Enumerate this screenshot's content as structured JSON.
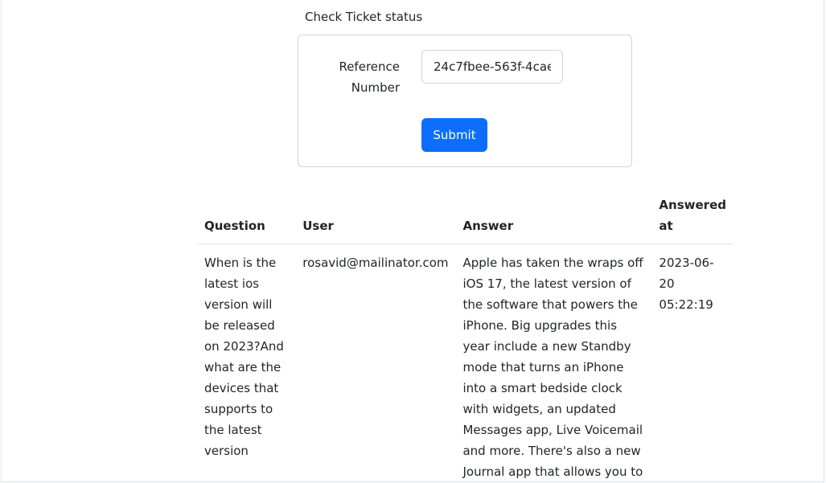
{
  "page": {
    "title": "Check Ticket status"
  },
  "form": {
    "reference_label": "Reference Number",
    "reference_value": "24c7fbee-563f-4cae",
    "submit_label": "Submit"
  },
  "table": {
    "headers": {
      "question": "Question",
      "user": "User",
      "answer": "Answer",
      "answered_at": "Answered at"
    },
    "rows": [
      {
        "question": "When is the latest ios version will be released on 2023?And what are the devices that supports to the latest version",
        "user": "rosavid@mailinator.com",
        "answer": "Apple has taken the wraps off iOS 17, the latest version of the software that powers the iPhone. Big upgrades this year include a new Standby mode that turns an iPhone into a smart bedside clock with widgets, an updated Messages app, Live Voicemail and more. There's also a new Journal app that allows you to jot down",
        "answered_at": "2023-06-20 05:22:19"
      }
    ]
  }
}
